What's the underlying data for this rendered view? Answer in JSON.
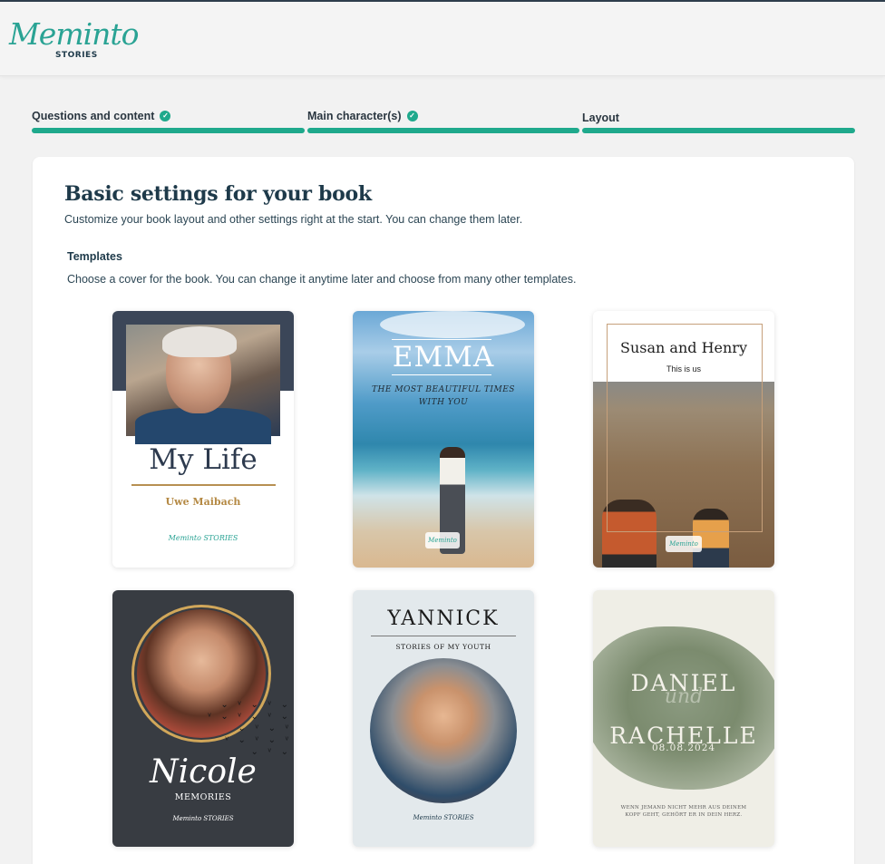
{
  "header": {
    "logo_script": "Meminto",
    "logo_sub": "STORIES"
  },
  "steps": [
    {
      "label": "Questions and content",
      "completed": true
    },
    {
      "label": "Main character(s)",
      "completed": true
    },
    {
      "label": "Layout",
      "completed": false
    }
  ],
  "page": {
    "title": "Basic settings for your book",
    "subtitle": "Customize your book layout and other settings right at the start. You can change them later."
  },
  "templates_section": {
    "label": "Templates",
    "description": "Choose a cover for the book. You can change it anytime later and choose from many other templates."
  },
  "templates": [
    {
      "title": "My Life",
      "author": "Uwe Maibach",
      "logo": "Meminto STORIES"
    },
    {
      "title": "EMMA",
      "subtitle": "THE MOST BEAUTIFUL TIMES WITH YOU",
      "logo": "Meminto"
    },
    {
      "title": "Susan and Henry",
      "subtitle": "This is us",
      "logo": "Meminto"
    },
    {
      "title": "Nicole",
      "subtitle": "MEMORIES",
      "logo": "Meminto STORIES"
    },
    {
      "title": "YANNICK",
      "subtitle": "STORIES OF MY YOUTH",
      "logo": "Meminto STORIES"
    },
    {
      "title_line1": "DANIEL",
      "title_connector": "und",
      "title_line2": "RACHELLE",
      "date": "08.08.2024",
      "quote": "WENN JEMAND NICHT MEHR AUS DEINEM KOPF GEHT, GEHÖRT ER IN DEIN HERZ."
    }
  ],
  "colors": {
    "accent": "#1fa98c",
    "brand": "#2aa394",
    "heading": "#1e3a4a"
  },
  "icons": {
    "step_check": "check-circle-icon"
  }
}
